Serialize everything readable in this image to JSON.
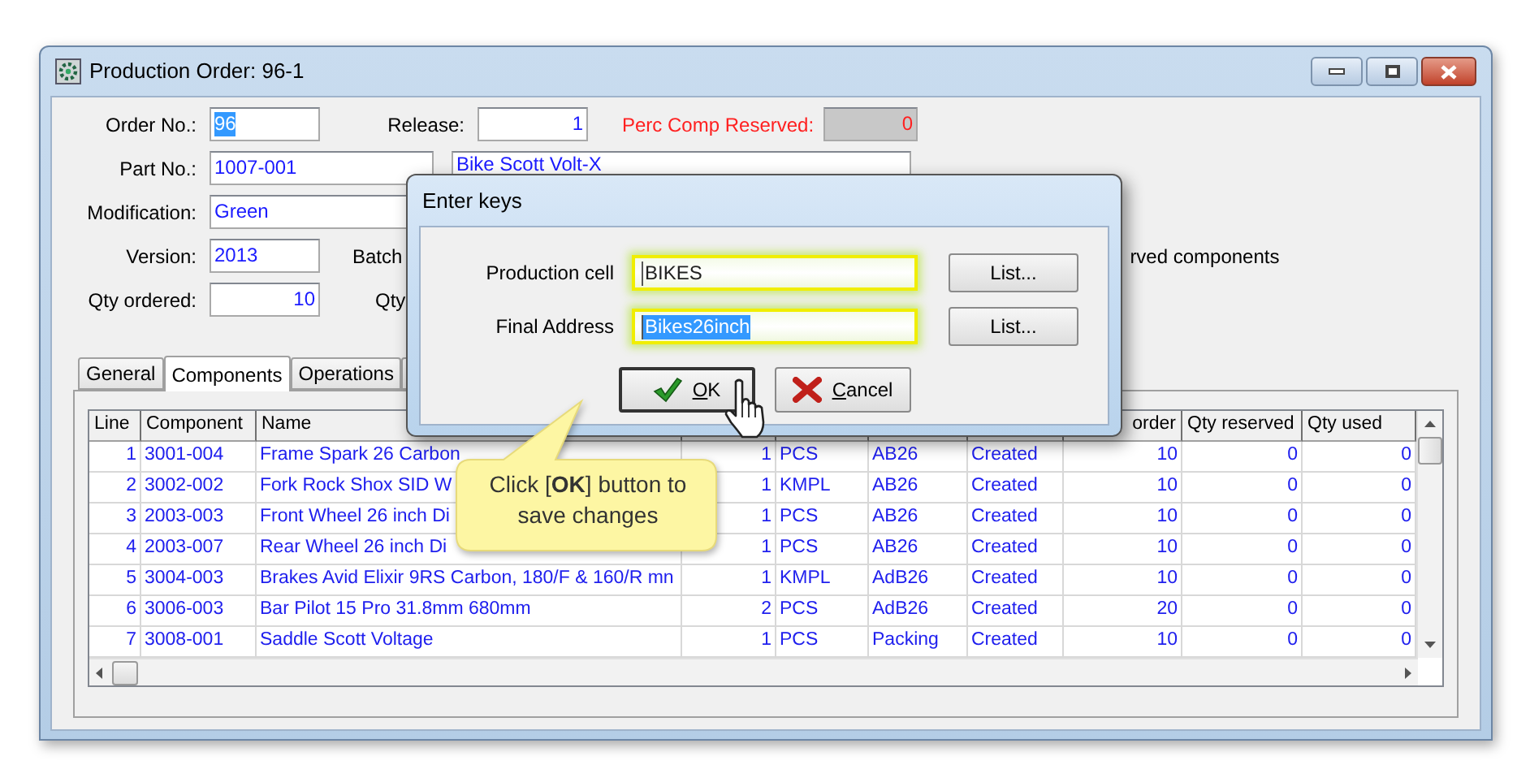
{
  "window": {
    "title": "Production Order: 96-1"
  },
  "form": {
    "order_no": {
      "label": "Order No.:",
      "value": "96",
      "text_selected": true
    },
    "release": {
      "label": "Release:",
      "value": "1"
    },
    "perc_comp_reserved": {
      "label": "Perc Comp Reserved:",
      "value": "0",
      "read_only": true
    },
    "part_no": {
      "label": "Part No.:",
      "value": "1007-001",
      "description": "Bike Scott Volt-X"
    },
    "modification": {
      "label": "Modification:",
      "value": "Green"
    },
    "version": {
      "label": "Version:",
      "value": "2013"
    },
    "batch_label": "Batch",
    "reserved_components_label": "rved components",
    "qty_ordered": {
      "label": "Qty ordered:",
      "value": "10"
    },
    "qty_label": "Qty"
  },
  "tabs": [
    {
      "label": "General",
      "selected": false
    },
    {
      "label": "Components",
      "selected": true
    },
    {
      "label": "Operations",
      "selected": false
    }
  ],
  "table": {
    "headers_left": [
      "Line",
      "Component",
      "Name"
    ],
    "headers_right": [
      "order",
      "Qty reserved",
      "Qty used"
    ],
    "rows": [
      [
        "1",
        "3001-004",
        "Frame Spark 26 Carbon",
        "1",
        "PCS",
        "AB26",
        "Created",
        "10",
        "0",
        "0"
      ],
      [
        "2",
        "3002-002",
        "Fork Rock Shox SID W",
        "1",
        "KMPL",
        "AB26",
        "Created",
        "10",
        "0",
        "0"
      ],
      [
        "3",
        "2003-003",
        "Front Wheel 26 inch Di",
        "1",
        "PCS",
        "AB26",
        "Created",
        "10",
        "0",
        "0"
      ],
      [
        "4",
        "2003-007",
        "Rear Wheel 26 inch Di",
        "1",
        "PCS",
        "AB26",
        "Created",
        "10",
        "0",
        "0"
      ],
      [
        "5",
        "3004-003",
        "Brakes Avid Elixir 9RS Carbon, 180/F & 160/R mn",
        "1",
        "KMPL",
        "AdB26",
        "Created",
        "10",
        "0",
        "0"
      ],
      [
        "6",
        "3006-003",
        "Bar Pilot 15 Pro 31.8mm 680mm",
        "2",
        "PCS",
        "AdB26",
        "Created",
        "20",
        "0",
        "0"
      ],
      [
        "7",
        "3008-001",
        "Saddle Scott Voltage",
        "1",
        "PCS",
        "Packing",
        "Created",
        "10",
        "0",
        "0"
      ]
    ]
  },
  "dialog": {
    "title": "Enter keys",
    "fields": [
      {
        "label": "Production cell",
        "value": "BIKES",
        "highlighted": true,
        "text_selected": false,
        "button": "List..."
      },
      {
        "label": "Final Address",
        "value": "Bikes26inch",
        "highlighted": true,
        "text_selected": true,
        "button": "List..."
      }
    ],
    "ok": {
      "label": "OK",
      "focused": true
    },
    "cancel": {
      "label": "Cancel",
      "focused": false
    }
  },
  "callout": {
    "text": "Click [**OK**] button to save changes"
  }
}
